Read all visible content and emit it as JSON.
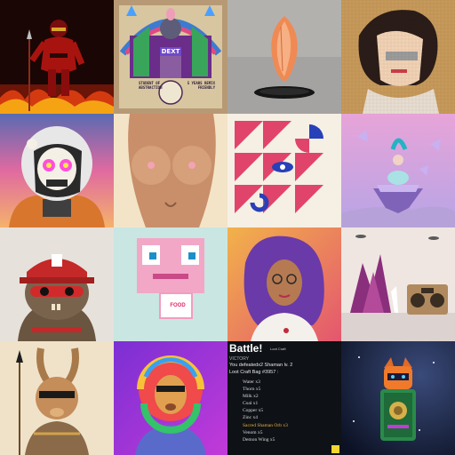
{
  "grid": {
    "columns": 4,
    "rows": 4
  },
  "poster": {
    "label": "DEXT",
    "left_caption": "STUDENT OF ABSTRACTION",
    "right_caption": "5 YEARS REMIX FRIENDLY"
  },
  "billboard": {
    "text": "FOOD"
  },
  "battle": {
    "title": "Battle!",
    "subtitle": "Loot Craft",
    "status": "VICTORY",
    "summary": "You defeatedx2 Shaman lv. 2",
    "bag": "Loot Craft Bag #3957 :",
    "loot": [
      {
        "text": "Water x3",
        "highlight": false
      },
      {
        "text": "Thorn x5",
        "highlight": false
      },
      {
        "text": "Milk x2",
        "highlight": false
      },
      {
        "text": "Coal x1",
        "highlight": false
      },
      {
        "text": "Copper x5",
        "highlight": false
      },
      {
        "text": "Zinc x4",
        "highlight": false
      },
      {
        "text": "Sacred Shaman Orb x3",
        "highlight": true
      },
      {
        "text": "Venom x5",
        "highlight": false
      },
      {
        "text": "Demon Wing x5",
        "highlight": false
      }
    ]
  },
  "colors": {
    "battle_bg": "#0e1116",
    "highlight": "#e8b341",
    "badge": "#f5d52e"
  }
}
